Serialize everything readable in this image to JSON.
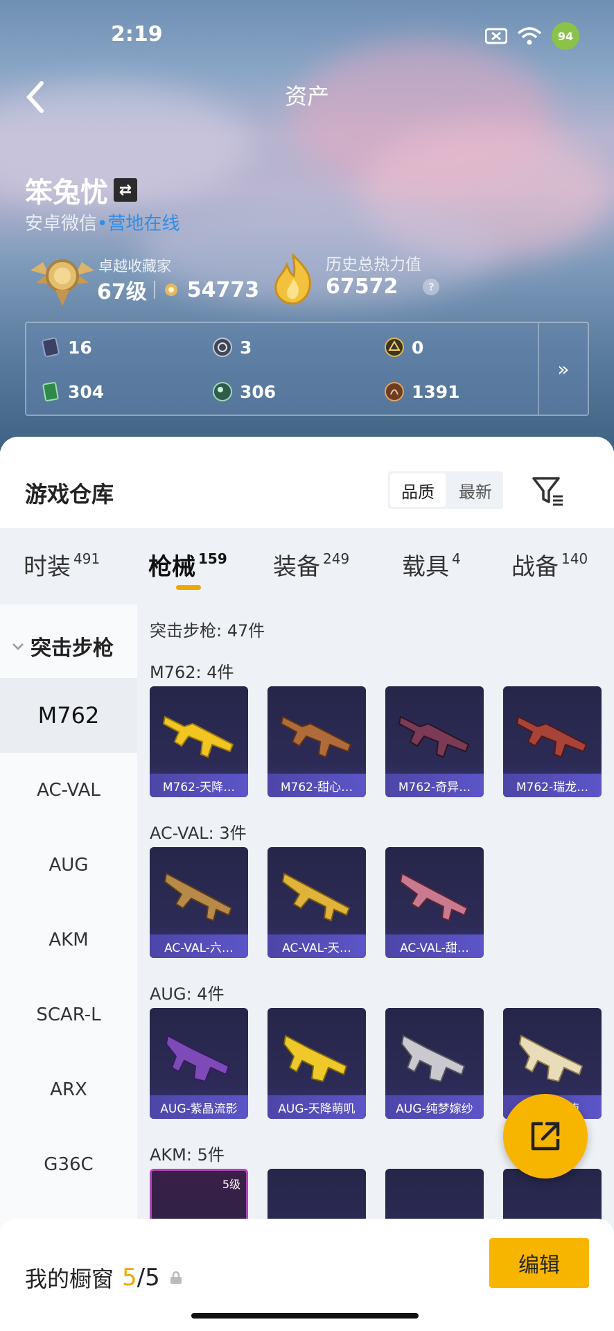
{
  "status": {
    "time": "2:19",
    "battery": "94"
  },
  "header": {
    "title": "资产"
  },
  "profile": {
    "name": "笨兔忧",
    "platform": "安卓微信",
    "online_dot": "•",
    "online": "营地在线"
  },
  "level": {
    "label": "卓越收藏家",
    "level": "67级",
    "points": "54773"
  },
  "heat": {
    "label": "历史总热力值",
    "value": "67572",
    "help": "?"
  },
  "currencies": [
    {
      "value": "16",
      "icon": "card-icon"
    },
    {
      "value": "3",
      "icon": "coin-icon"
    },
    {
      "value": "0",
      "icon": "gold-coin-icon"
    },
    {
      "value": "304",
      "icon": "ticket-icon"
    },
    {
      "value": "306",
      "icon": "green-coin-icon"
    },
    {
      "value": "1391",
      "icon": "bronze-coin-icon"
    }
  ],
  "more_arrow": "»",
  "warehouse": {
    "title": "游戏仓库",
    "toggle": [
      "品质",
      "最新"
    ]
  },
  "tabs": [
    {
      "label": "时装",
      "count": "491"
    },
    {
      "label": "枪械",
      "count": "159"
    },
    {
      "label": "装备",
      "count": "249"
    },
    {
      "label": "载具",
      "count": "4"
    },
    {
      "label": "战备",
      "count": "140"
    }
  ],
  "sidebar": {
    "group": "突击步枪",
    "items": [
      "M762",
      "AC-VAL",
      "AUG",
      "AKM",
      "SCAR-L",
      "ARX",
      "G36C"
    ]
  },
  "main": {
    "summary": "突击步枪: 47件",
    "groups": [
      {
        "title": "M762: 4件",
        "items": [
          "M762-天降…",
          "M762-甜心…",
          "M762-奇异…",
          "M762-瑞龙…"
        ]
      },
      {
        "title": "AC-VAL: 3件",
        "items": [
          "AC-VAL-六…",
          "AC-VAL-天…",
          "AC-VAL-甜…"
        ]
      },
      {
        "title": "AUG: 4件",
        "items": [
          "AUG-紫晶流影",
          "AUG-天降萌叽",
          "AUG-纯梦嫁纱",
          "AUG-…使"
        ]
      },
      {
        "title": "AKM: 5件",
        "badge": "5级"
      }
    ]
  },
  "bottom": {
    "label": "我的橱窗",
    "count": "5",
    "total": "/5",
    "edit": "编辑"
  },
  "colors": {
    "accent": "#f7b500",
    "online": "#2d8ee9",
    "label_bar": "#5c55c8"
  }
}
